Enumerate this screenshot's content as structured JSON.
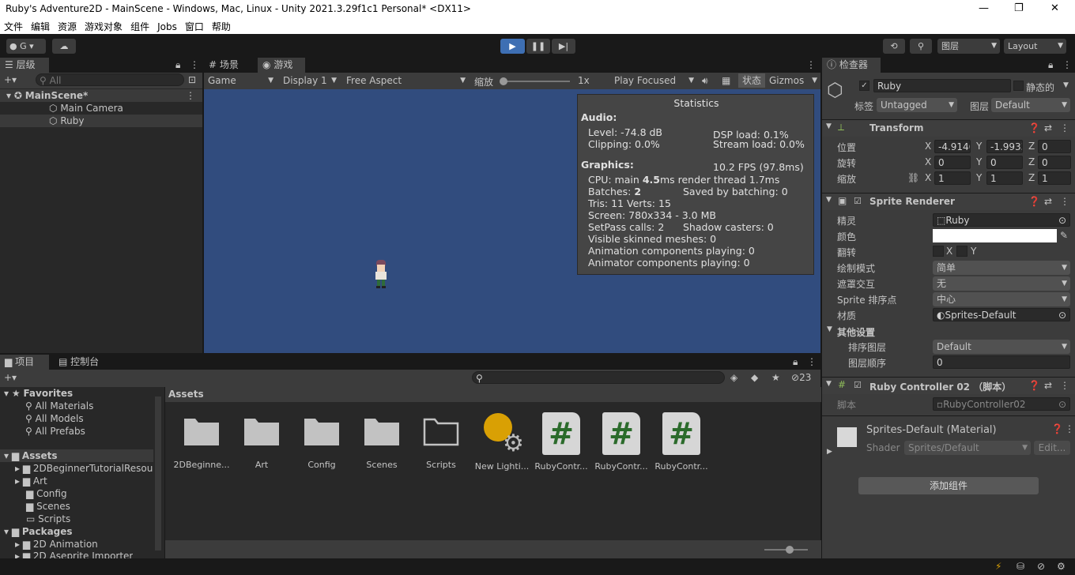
{
  "window": {
    "title": "Ruby's Adventure2D - MainScene - Windows, Mac, Linux - Unity 2021.3.29f1c1 Personal* <DX11>",
    "minimize": "—",
    "maximize": "❐",
    "close": "✕"
  },
  "menu": [
    "文件",
    "编辑",
    "资源",
    "游戏对象",
    "组件",
    "Jobs",
    "窗口",
    "帮助"
  ],
  "toolbar": {
    "account": "G",
    "layers": "图层",
    "layout": "Layout"
  },
  "hierarchy": {
    "tab": "层级",
    "search_placeholder": "All",
    "scene": "MainScene*",
    "items": [
      "Main Camera",
      "Ruby"
    ]
  },
  "game": {
    "tabs": [
      "场景",
      "游戏"
    ],
    "display_mode": "Game",
    "display": "Display 1",
    "aspect": "Free Aspect",
    "scale_label": "缩放",
    "scale_value": "1x",
    "play_mode": "Play Focused",
    "stats_btn": "状态",
    "gizmos": "Gizmos"
  },
  "stats": {
    "title": "Statistics",
    "audio_hdr": "Audio:",
    "level": "Level: -74.8 dB",
    "dsp": "DSP load: 0.1%",
    "clipping": "Clipping: 0.0%",
    "stream": "Stream load: 0.0%",
    "graphics_hdr": "Graphics:",
    "fps": "10.2 FPS (97.8ms)",
    "cpu_pre": "CPU: main ",
    "cpu_main": "4.5",
    "cpu_post": "ms  render thread 1.7ms",
    "batches_pre": "Batches: ",
    "batches": "2",
    "saved": "Saved by batching: 0",
    "tris": "Tris: 11    Verts: 15",
    "screen": "Screen: 780x334 - 3.0 MB",
    "setpass": "SetPass calls: 2",
    "shadow": "Shadow casters: 0",
    "skinned": "Visible skinned meshes: 0",
    "anim": "Animation components playing: 0",
    "animator": "Animator components playing: 0"
  },
  "project": {
    "tabs": [
      "项目",
      "控制台"
    ],
    "hidden_count": "23",
    "tree": [
      "Favorites",
      "All Materials",
      "All Models",
      "All Prefabs",
      "Assets",
      "2DBeginnerTutorialResou",
      "Art",
      "Config",
      "Scenes",
      "Scripts",
      "Packages",
      "2D Animation",
      "2D Aseprite Importer"
    ],
    "breadcrumb": "Assets",
    "assets": [
      "2DBeginne...",
      "Art",
      "Config",
      "Scenes",
      "Scripts",
      "New Lighti...",
      "RubyContr...",
      "RubyContr...",
      "RubyContr..."
    ]
  },
  "inspector": {
    "tab": "检查器",
    "name": "Ruby",
    "static": "静态的",
    "tag_label": "标签",
    "tag": "Untagged",
    "layer_label": "图层",
    "layer": "Default",
    "transform": {
      "title": "Transform",
      "pos": "位置",
      "rot": "旋转",
      "scale": "缩放",
      "px": "-4.9146",
      "py": "-1.9933",
      "pz": "0",
      "rx": "0",
      "ry": "0",
      "rz": "0",
      "sx": "1",
      "sy": "1",
      "sz": "1"
    },
    "sprite_renderer": {
      "title": "Sprite Renderer",
      "sprite_lbl": "精灵",
      "sprite": "Ruby",
      "color_lbl": "颜色",
      "flip_lbl": "翻转",
      "draw_lbl": "绘制模式",
      "draw": "简单",
      "mask_lbl": "遮罩交互",
      "mask": "无",
      "pivot_lbl": "Sprite 排序点",
      "pivot": "中心",
      "mat_lbl": "材质",
      "mat": "Sprites-Default",
      "other": "其他设置",
      "sort_lbl": "排序图层",
      "sort": "Default",
      "order_lbl": "图层顺序",
      "order": "0"
    },
    "script": {
      "title": "Ruby Controller 02 （脚本）",
      "lbl": "脚本",
      "value": "RubyController02"
    },
    "material": {
      "title": "Sprites-Default (Material)",
      "shader_lbl": "Shader",
      "shader": "Sprites/Default",
      "edit": "Edit..."
    },
    "add_component": "添加组件"
  },
  "axes": {
    "x": "X",
    "y": "Y",
    "z": "Z"
  }
}
